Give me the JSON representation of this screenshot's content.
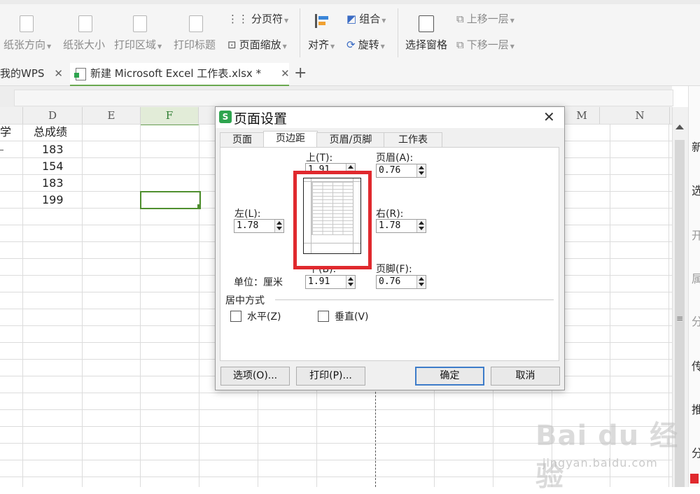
{
  "ribbon": {
    "paper_orientation": "纸张方向",
    "paper_size": "纸张大小",
    "print_area": "打印区域",
    "print_titles": "打印标题",
    "page_break": "分页符",
    "page_zoom": "页面缩放",
    "align": "对齐",
    "group": "组合",
    "rotate": "旋转",
    "selection_pane": "选择窗格",
    "bring_forward": "上移一层",
    "send_backward": "下移一层"
  },
  "tabs": {
    "home": "我的WPS",
    "file": "新建 Microsoft Excel 工作表.xlsx *",
    "new_tab": "+"
  },
  "columns": [
    "D",
    "E",
    "F",
    "M",
    "N"
  ],
  "sheet": {
    "partial_header": "学",
    "header": "总成绩",
    "values": [
      "183",
      "154",
      "183",
      "199"
    ]
  },
  "dialog": {
    "title": "页面设置",
    "logo": "S",
    "close": "✕",
    "tabs": [
      "页面",
      "页边距",
      "页眉/页脚",
      "工作表"
    ],
    "active_tab": "页边距",
    "top_label": "上(T):",
    "top_value": "1.91",
    "header_label": "页眉(A):",
    "header_value": "0.76",
    "left_label": "左(L):",
    "left_value": "1.78",
    "right_label": "右(R):",
    "right_value": "1.78",
    "bottom_label": "下(B):",
    "bottom_value": "1.91",
    "footer_label": "页脚(F):",
    "footer_value": "0.76",
    "unit_label": "单位：厘米",
    "center_section": "居中方式",
    "horizontal": "水平(Z)",
    "vertical": "垂直(V)",
    "options_button": "选项(O)...",
    "print_button": "打印(P)...",
    "ok_button": "确定",
    "cancel_button": "取消"
  },
  "side_panel_chars": [
    "新",
    "选",
    "开",
    "属",
    "分",
    "传",
    "推",
    "分"
  ],
  "watermark": {
    "logo": "Bai du 经验",
    "url": "jingyan.baidu.com"
  },
  "colors": {
    "accent_green": "#6aa84f",
    "preview_highlight": "#e0292e",
    "primary_button_border": "#3d7cc9"
  }
}
